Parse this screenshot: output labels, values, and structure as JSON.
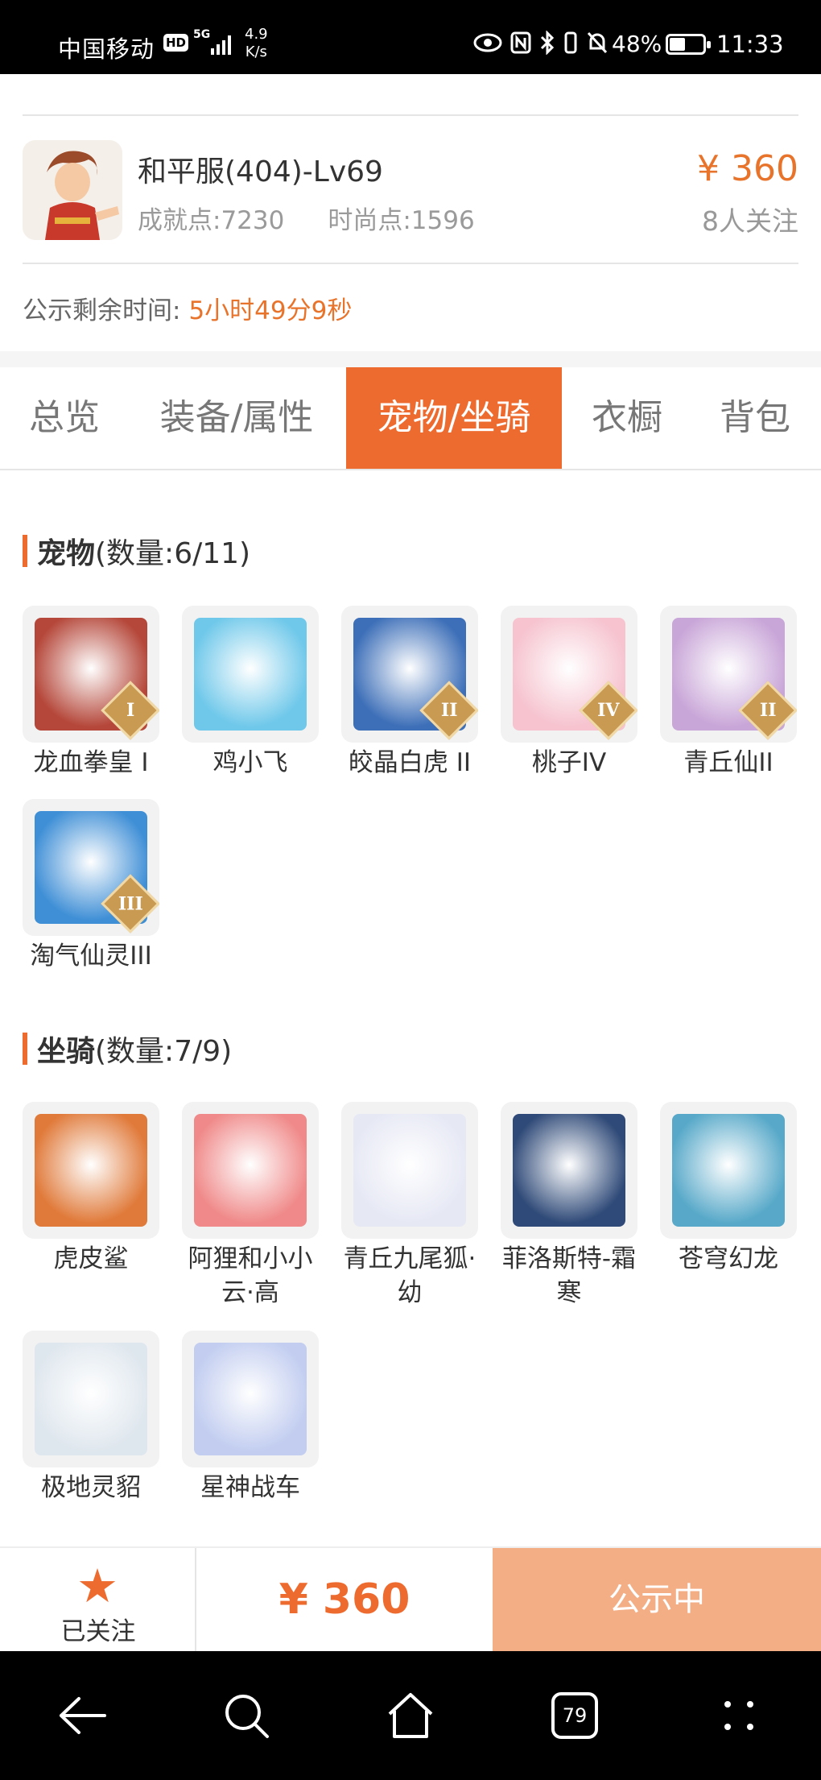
{
  "status_bar": {
    "carrier": "中国移动",
    "hd": "HD",
    "network": "5G",
    "speed_value": "4.9",
    "speed_unit": "K/s",
    "battery": "48%",
    "battery_level": 0.48,
    "time": "11:33"
  },
  "listing": {
    "server_name": "和平服(404)-Lv69",
    "achievement": "成就点:7230",
    "fashion": "时尚点:1596",
    "price": "¥ 360",
    "watchers": "8人关注",
    "notice_label": "公示剩余时间:",
    "notice_countdown": "5小时49分9秒"
  },
  "tabs": [
    {
      "label": "总览",
      "active": false
    },
    {
      "label": "装备/属性",
      "active": false
    },
    {
      "label": "宠物/坐骑",
      "active": true
    },
    {
      "label": "衣橱",
      "active": false
    },
    {
      "label": "背包",
      "active": false
    }
  ],
  "pets": {
    "title": "宠物",
    "count": "(数量:6/11)",
    "items": [
      {
        "name": "龙血拳皇 I",
        "badge": "I",
        "color": "#b5473a"
      },
      {
        "name": "鸡小飞",
        "badge": "",
        "color": "#6fc8ea"
      },
      {
        "name": "皎晶白虎 II",
        "badge": "II",
        "color": "#3d6fb8"
      },
      {
        "name": "桃子IV",
        "badge": "IV",
        "color": "#f6c3cf"
      },
      {
        "name": "青丘仙II",
        "badge": "II",
        "color": "#c9a6d8"
      },
      {
        "name": "淘气仙灵III",
        "badge": "III",
        "color": "#3f8fd6"
      }
    ]
  },
  "mounts": {
    "title": "坐骑",
    "count": "(数量:7/9)",
    "items": [
      {
        "name": "虎皮鲨",
        "color": "#e07a3a"
      },
      {
        "name": "阿狸和小小云·高",
        "color": "#f08a8a"
      },
      {
        "name": "青丘九尾狐·幼",
        "color": "#e6e8f4"
      },
      {
        "name": "菲洛斯特-霜寒",
        "color": "#2f4a78"
      },
      {
        "name": "苍穹幻龙",
        "color": "#58a9c9"
      },
      {
        "name": "极地灵貂",
        "color": "#dfe7ee"
      },
      {
        "name": "星神战车",
        "color": "#c2cdf0"
      }
    ]
  },
  "bottom_bar": {
    "follow_label": "已关注",
    "price": "¥ 360",
    "status": "公示中"
  },
  "nav": {
    "tabs_count": "79"
  }
}
